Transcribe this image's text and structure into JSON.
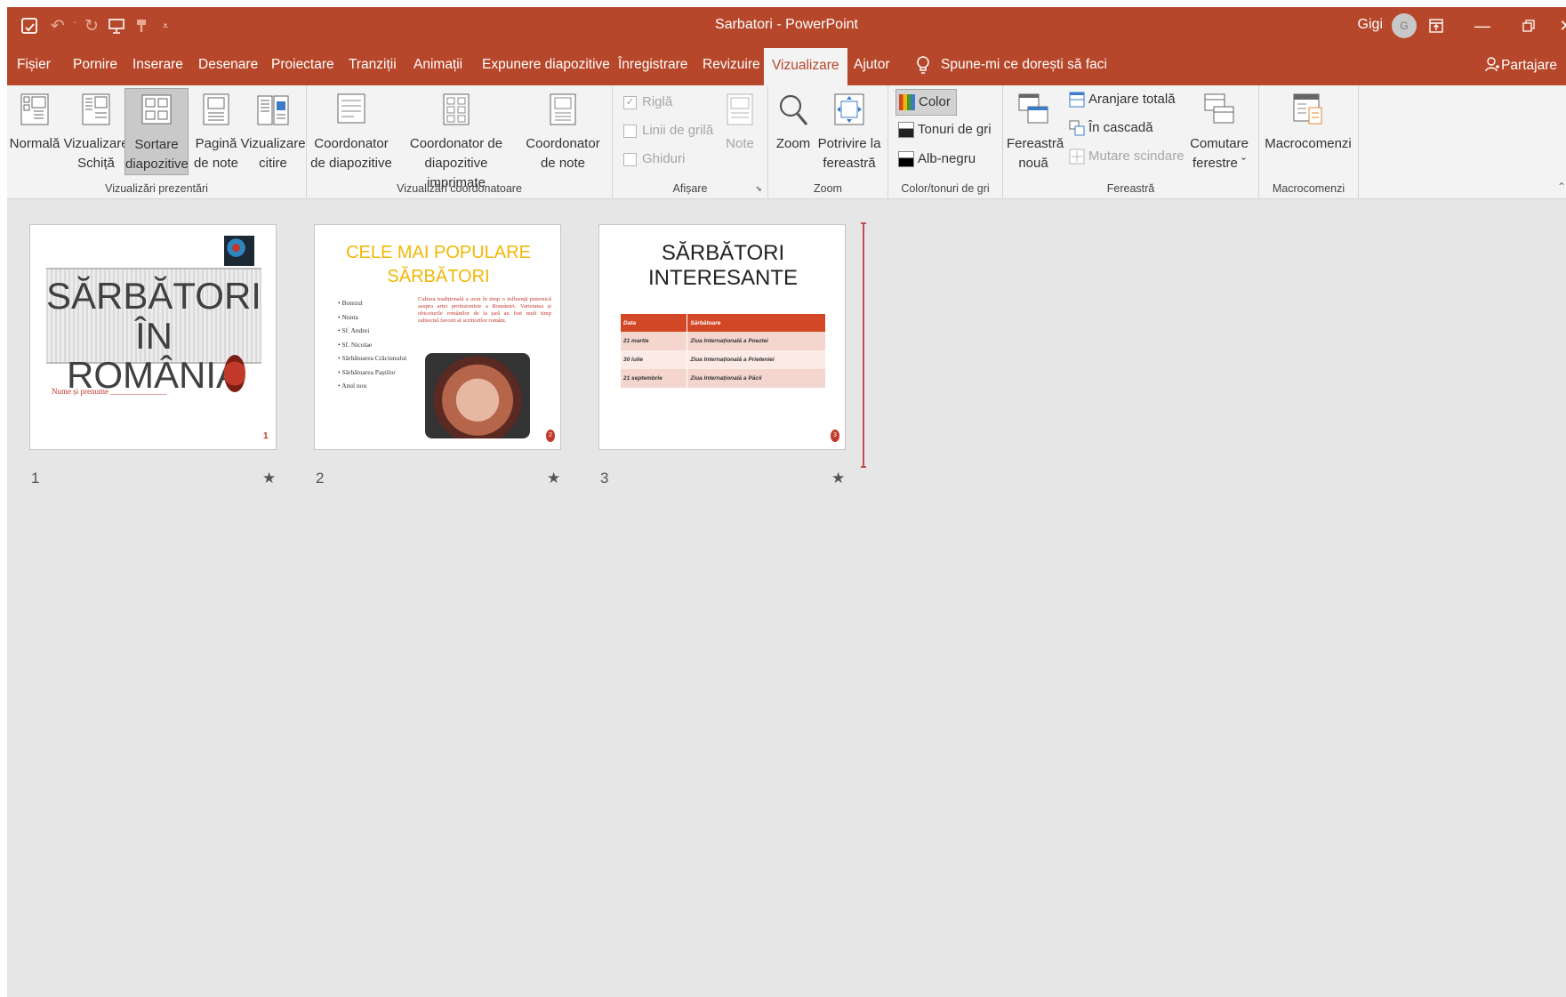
{
  "window": {
    "title": "Sarbatori  -  PowerPoint",
    "user": "Gigi",
    "avatar_initial": "G"
  },
  "tabs": {
    "file": "Fișier",
    "home": "Pornire",
    "insert": "Inserare",
    "draw": "Desenare",
    "design": "Proiectare",
    "transitions": "Tranziții",
    "animations": "Animații",
    "slideshow": "Expunere diapozitive",
    "record": "Înregistrare",
    "review": "Revizuire",
    "view": "Vizualizare",
    "help": "Ajutor"
  },
  "tell_me": "Spune-mi ce dorești să faci",
  "share": "Partajare",
  "ribbon": {
    "presentation_views": {
      "label": "Vizualizări prezentări",
      "normal": "Normală",
      "outline_1": "Vizualizare",
      "outline_2": "Schiță",
      "sorter_1": "Sortare",
      "sorter_2": "diapozitive",
      "notes_1": "Pagină",
      "notes_2": "de note",
      "reading_1": "Vizualizare",
      "reading_2": "citire"
    },
    "master_views": {
      "label": "Vizualizări coordonatoare",
      "slide_master_1": "Coordonator",
      "slide_master_2": "de diapozitive",
      "handout_master_1": "Coordonator de",
      "handout_master_2": "diapozitive imprimate",
      "notes_master_1": "Coordonator",
      "notes_master_2": "de note"
    },
    "show": {
      "label": "Afișare",
      "ruler": "Riglă",
      "gridlines": "Linii de grilă",
      "guides": "Ghiduri",
      "notes": "Note"
    },
    "zoom": {
      "label": "Zoom",
      "zoom": "Zoom",
      "fit_1": "Potrivire la",
      "fit_2": "fereastră"
    },
    "color": {
      "label": "Color/tonuri de gri",
      "color": "Color",
      "grayscale": "Tonuri de gri",
      "bw": "Alb-negru"
    },
    "window": {
      "label": "Fereastră",
      "new_1": "Fereastră",
      "new_2": "nouă",
      "arrange_all": "Aranjare totală",
      "cascade": "În cascadă",
      "move_split": "Mutare scindare",
      "switch_1": "Comutare",
      "switch_2": "ferestre ˇ"
    },
    "macros": {
      "label": "Macrocomenzi",
      "macros": "Macrocomenzi"
    }
  },
  "slides": [
    {
      "number": "1",
      "title_1": "SĂRBĂTORI",
      "title_2": "ÎN ROMÂNIA",
      "name_line": "Nume și prenume ______________",
      "page": "1"
    },
    {
      "number": "2",
      "title_1": "CELE MAI POPULARE",
      "title_2": "SĂRBĂTORI",
      "bullets": [
        "Botezul",
        "Nunta",
        "Sf. Andrei",
        "Sf. Nicolae",
        "Sărbătoarea Crăciunului",
        "Sărbătoarea Paștilor",
        "Anul nou"
      ],
      "body": "Cultura tradițională a avut în timp o influență puternică asupra artei profesioniste a României. Varietatea și obiceiurile românilor de la țară au fost mult timp subiectul favorit al scriitorilor români.",
      "page": "2"
    },
    {
      "number": "3",
      "title_1": "SĂRBĂTORI",
      "title_2": "INTERESANTE",
      "table_header": [
        "Data",
        "Sărbătoare"
      ],
      "table_rows": [
        [
          "21 martie",
          "Ziua Internațională a Poeziei"
        ],
        [
          "30 iulie",
          "Ziua Internațională a Prieteniei"
        ],
        [
          "21 septembrie",
          "Ziua Internațională a Păcii"
        ]
      ],
      "page": "3"
    }
  ],
  "colors": {
    "accent": "#b7472a",
    "ribbon_bg": "#f3f3f3",
    "workspace": "#e6e6e6",
    "slide2_title": "#f2b705"
  }
}
